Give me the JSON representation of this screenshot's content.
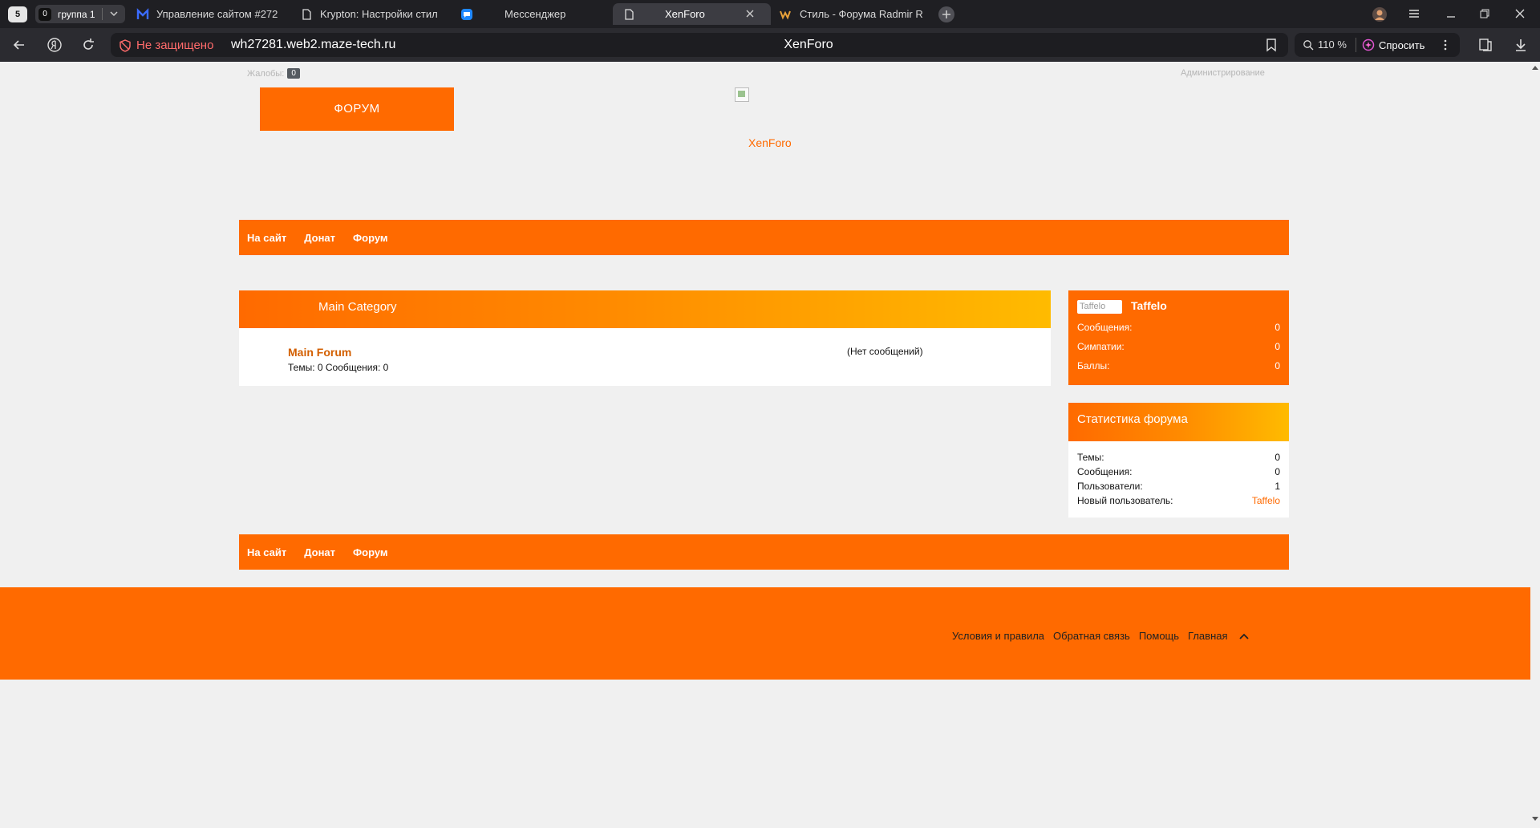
{
  "browser": {
    "tab_count": "5",
    "group": {
      "count": "0",
      "label": "группа 1"
    },
    "tabs": [
      {
        "label": "Управление сайтом #272"
      },
      {
        "label": "Krypton: Настройки стил"
      },
      {
        "label": "Мессенджер"
      },
      {
        "label": "XenForo"
      },
      {
        "label": "Стиль - Форума Radmir R"
      }
    ],
    "security_label": "Не защищено",
    "url": "wh27281.web2.maze-tech.ru",
    "page_title": "XenForo",
    "zoom": "110 %",
    "ask_label": "Спросить"
  },
  "header": {
    "complaints_label": "Жалобы:",
    "complaints_count": "0",
    "admin_label": "Администрирование",
    "logo_label": "ФОРУМ",
    "site_link": "XenForo"
  },
  "nav": {
    "items": [
      "На сайт",
      "Донат",
      "Форум"
    ]
  },
  "category": {
    "title": "Main Category",
    "forum": {
      "title": "Main Forum",
      "stats": "Темы: 0 Сообщения: 0",
      "last_post": "(Нет сообщений)"
    }
  },
  "user": {
    "avatar_alt": "Taffelo",
    "name": "Taffelo",
    "stats": [
      {
        "label": "Сообщения:",
        "value": "0"
      },
      {
        "label": "Симпатии:",
        "value": "0"
      },
      {
        "label": "Баллы:",
        "value": "0"
      }
    ]
  },
  "forum_stats": {
    "title": "Статистика форума",
    "rows": [
      {
        "label": "Темы:",
        "value": "0"
      },
      {
        "label": "Сообщения:",
        "value": "0"
      },
      {
        "label": "Пользователи:",
        "value": "1"
      },
      {
        "label": "Новый пользователь:",
        "value": "Taffelo"
      }
    ]
  },
  "footer": {
    "links": [
      "Условия и правила",
      "Обратная связь",
      "Помощь",
      "Главная"
    ]
  },
  "colors": {
    "accent": "#ff6a00",
    "gradient_end": "#ffbb00",
    "chrome_bg": "#1f1f23"
  }
}
